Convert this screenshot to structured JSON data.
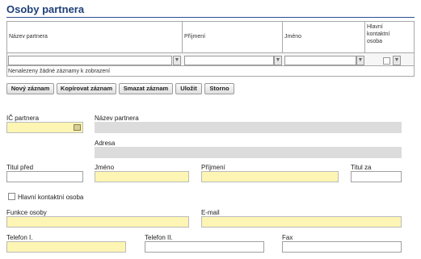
{
  "page": {
    "title": "Osoby partnera"
  },
  "grid": {
    "columns": [
      "Název partnera",
      "Příjmení",
      "Jméno",
      "Hlavní kontaktní osoba"
    ],
    "empty_message": "Nenalezeny žádné záznamy k zobrazení"
  },
  "toolbar": {
    "new": "Nový záznam",
    "copy": "Kopírovat záznam",
    "delete": "Smazat záznam",
    "save": "Uložit",
    "cancel": "Storno"
  },
  "form": {
    "ic_label": "IČ partnera",
    "name_label": "Název partnera",
    "address_label": "Adresa",
    "title_before_label": "Titul před",
    "first_name_label": "Jméno",
    "last_name_label": "Příjmení",
    "title_after_label": "Titul za",
    "main_contact_label": "Hlavní kontaktní osoba",
    "role_label": "Funkce osoby",
    "email_label": "E-mail",
    "phone1_label": "Telefon I.",
    "phone2_label": "Telefon II.",
    "fax_label": "Fax"
  },
  "icons": {
    "filter": "filter-icon",
    "lookup": "lookup-icon"
  },
  "colors": {
    "title": "#1f3f7a",
    "required_field": "#fdf5b3",
    "readonly_field": "#dcdcdc"
  }
}
